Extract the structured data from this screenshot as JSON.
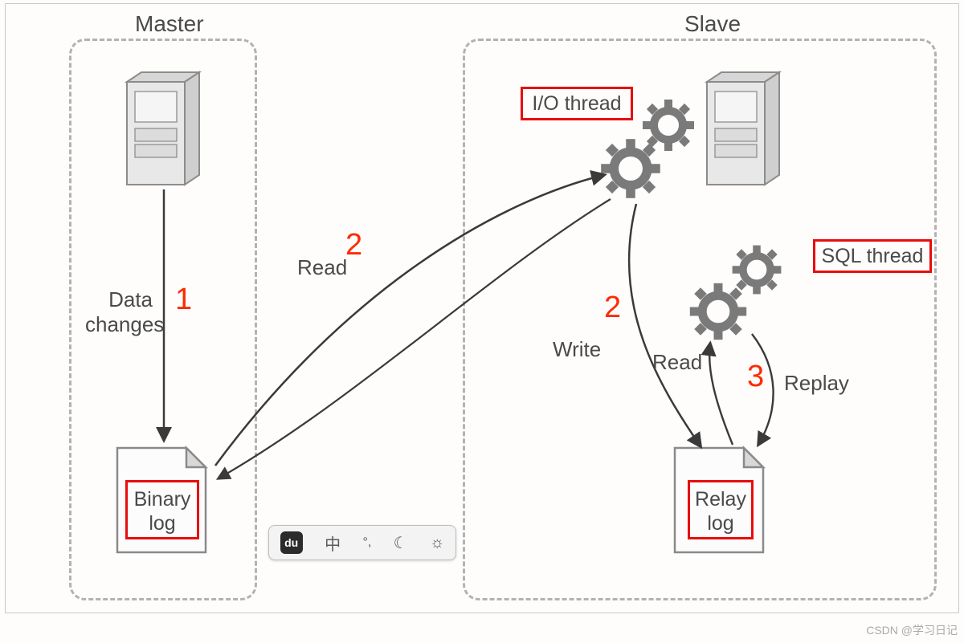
{
  "master": {
    "title": "Master",
    "data_changes_label": "Data\nchanges",
    "binary_log_label": "Binary\nlog"
  },
  "slave": {
    "title": "Slave",
    "io_thread_label": "I/O thread",
    "sql_thread_label": "SQL thread",
    "relay_log_label": "Relay\nlog"
  },
  "edges": {
    "read_label": "Read",
    "write_label": "Write",
    "read2_label": "Read",
    "replay_label": "Replay"
  },
  "steps": {
    "one": "1",
    "two_a": "2",
    "two_b": "2",
    "three": "3"
  },
  "ime": {
    "du": "du",
    "lang": "中",
    "punct": "°,",
    "moon": "☾",
    "sun": "☼"
  },
  "watermark": "CSDN @学习日记"
}
